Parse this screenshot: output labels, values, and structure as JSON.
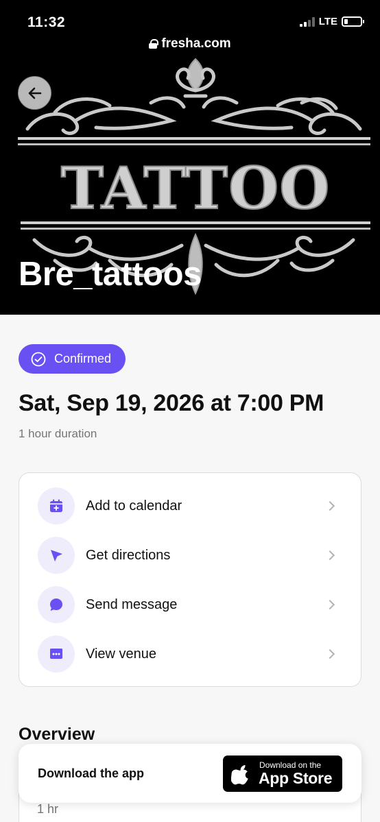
{
  "status_bar": {
    "time": "11:32",
    "network": "LTE"
  },
  "browser": {
    "url": "fresha.com"
  },
  "hero": {
    "logo_text": "TATTOO",
    "venue_name": "Bre_tattoos"
  },
  "booking": {
    "status": "Confirmed",
    "datetime": "Sat, Sep 19, 2026 at 7:00 PM",
    "duration": "1 hour duration"
  },
  "actions": [
    {
      "label": "Add to calendar",
      "icon": "calendar-icon"
    },
    {
      "label": "Get directions",
      "icon": "navigation-arrow-icon"
    },
    {
      "label": "Send message",
      "icon": "chat-bubble-icon"
    },
    {
      "label": "View venue",
      "icon": "storefront-icon"
    }
  ],
  "overview": {
    "heading": "Overview",
    "service_duration": "1 hr"
  },
  "download_banner": {
    "text": "Download the app",
    "store_small": "Download on the",
    "store_big": "App Store"
  },
  "colors": {
    "accent": "#6950f3",
    "accent_soft": "#efedfc"
  }
}
